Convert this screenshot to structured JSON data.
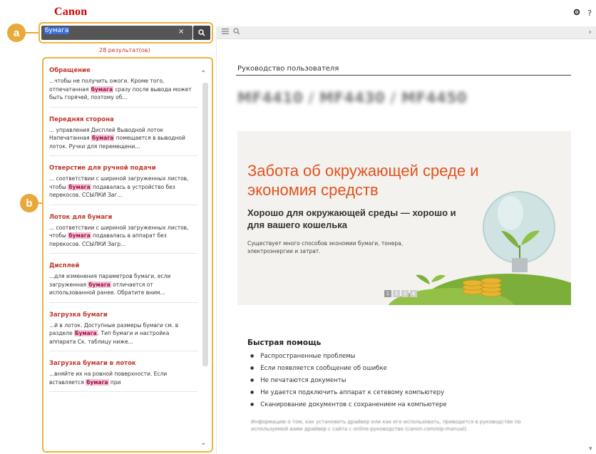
{
  "header": {
    "logo": "Canon",
    "settings_icon": "gear-icon",
    "help_icon": "question-icon",
    "help_label": "?"
  },
  "callouts": {
    "a": "a",
    "b": "b"
  },
  "search": {
    "value": "бумага",
    "clear_glyph": "×",
    "button_icon": "search-icon"
  },
  "toolbar": {
    "list_icon": "list-icon",
    "search_icon": "search-icon",
    "next_icon": "chevron-right-icon",
    "next_glyph": "›"
  },
  "results": {
    "count_text": "28 результат(ов)",
    "items": [
      {
        "title": "Обращение",
        "pre": "...чтобы не получить ожоги. Кроме того, отпечатанная ",
        "hit": "бумага",
        "post": " сразу после вывода может быть горячей, поэтому об..."
      },
      {
        "title": "Передняя сторона",
        "pre": "... управления Дисплей Выводной лоток Напечатанная ",
        "hit": "бумага",
        "post": " помещается в выводной лоток. Ручки для перемещени..."
      },
      {
        "title": "Отверстие для ручной подачи",
        "pre": "... соответствии с шириной загруженных листов, чтобы ",
        "hit": "бумага",
        "post": " подавалась в устройство без перекосов. ССЫЛКИ Заг..."
      },
      {
        "title": "Лоток для бумаги",
        "pre": "... соответствии с шириной загруженных листов, чтобы ",
        "hit": "бумага",
        "post": " подавалась в аппарат без перекосов. ССЫЛКИ Загр..."
      },
      {
        "title": "Дисплей",
        "pre": "...для изменения параметров бумаги, если загруженная ",
        "hit": "бумага",
        "post": " отличается от использованной ранее. Обратите вним..."
      },
      {
        "title": "Загрузка бумаги",
        "pre": "...й в лоток. Доступные размеры бумаги см. в разделе ",
        "hit": "Бумага",
        "post": ". Тип бумаги и настройка аппарата Ск. таблицу ниже..."
      },
      {
        "title": "Загрузка бумаги в лоток",
        "pre": "...вняйте их на ровной поверхности. Если вставляется ",
        "hit": "бумага",
        "post": " при"
      }
    ],
    "scroll_up_glyph": "⌃",
    "scroll_down_glyph": "⌄"
  },
  "content": {
    "guide_title": "Руководство пользователя",
    "model_title": "MF4410 / MF4430 / MF4450",
    "banner": {
      "title": "Забота об окружающей среде и экономия средств",
      "subtitle": "Хорошо для окружающей среды — хорошо и для вашего кошелька",
      "small": "Существует много способов экономии бумаги, тонера, электроэнергии и затрат.",
      "pages": [
        "1",
        "2",
        "3",
        "4"
      ],
      "active_page": 1
    },
    "quick_help": {
      "title": "Быстрая помощь",
      "items": [
        "Распространенные проблемы",
        "Если появляется сообщение об ошибке",
        "Не печатаются документы",
        "Не удается подключить аппарат к сетевому компьютеру",
        "Сканирование документов с сохранением на компьютере"
      ],
      "note": "Информацию о том, как установить драйвер или как его использовать, приводится в руководстве по используемой вами драйвер с сайта с online-руководство (canon.com/oip-manual)."
    }
  },
  "colors": {
    "brand": "#cc0000",
    "callout": "#e8a93b",
    "highlight": "#f3c4d6",
    "banner_title": "#e2521f"
  }
}
